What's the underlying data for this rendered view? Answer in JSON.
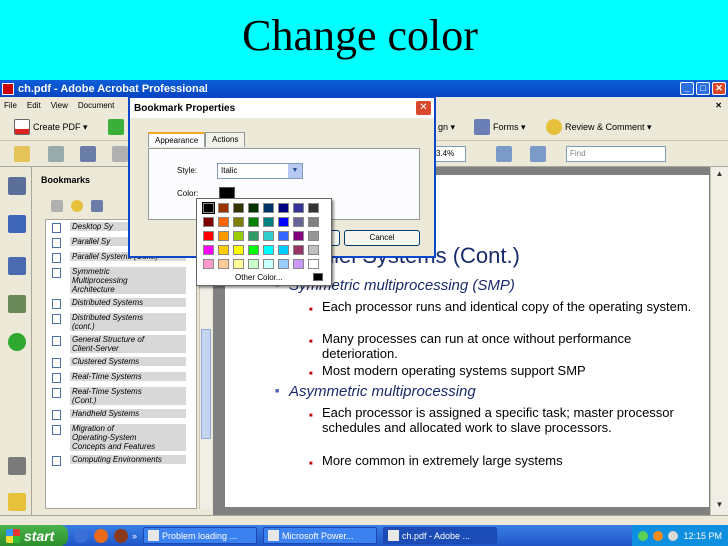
{
  "slide": {
    "title": "Change color"
  },
  "window": {
    "title": "ch.pdf - Adobe Acrobat Professional",
    "minimize": "_",
    "maximize": "□",
    "close": "✕"
  },
  "menu": {
    "items": [
      "File",
      "Edit",
      "View",
      "Document"
    ],
    "close_doc": "✕"
  },
  "toolbar": {
    "create_pdf": "Create PDF ▾",
    "sign": "gn ▾",
    "forms": "Forms ▾",
    "review": "Review & Comment ▾",
    "zoom": "3.4%",
    "find_placeholder": "Find"
  },
  "bookmarks": {
    "header": "Bookmarks",
    "items": [
      "Desktop Sy",
      "Parallel Sy",
      "Parallel Systems (Cont.)",
      "Symmetric\nMultiprocessing\nArchitecture",
      "Distributed Systems",
      "Distributed Systems\n(cont.)",
      "General Structure of\nClient-Server",
      "Clustered Systems",
      "Real-Time Systems",
      "Real-Time Systems\n(Cont.)",
      "Handheld Systems",
      "Migration of\nOperating-System\nConcepts and Features",
      "Computing Environments"
    ]
  },
  "dialog": {
    "title": "Bookmark Properties",
    "close": "✕",
    "tabs": [
      "Appearance",
      "Actions"
    ],
    "style_label": "Style:",
    "style_value": "Italic",
    "color_label": "Color:",
    "ok_label": "",
    "cancel_label": "Cancel"
  },
  "palette": {
    "colors": [
      "#000000",
      "#993300",
      "#333300",
      "#003300",
      "#003366",
      "#000080",
      "#333399",
      "#333333",
      "#800000",
      "#ff6600",
      "#808000",
      "#008000",
      "#008080",
      "#0000ff",
      "#666699",
      "#808080",
      "#ff0000",
      "#ff9900",
      "#99cc00",
      "#339966",
      "#33cccc",
      "#3366ff",
      "#800080",
      "#969696",
      "#ff00ff",
      "#ffcc00",
      "#ffff00",
      "#00ff00",
      "#00ffff",
      "#00ccff",
      "#993366",
      "#c0c0c0",
      "#ff99cc",
      "#ffcc99",
      "#ffff99",
      "#ccffcc",
      "#ccffff",
      "#99ccff",
      "#cc99ff",
      "#ffffff"
    ],
    "other_label": "Other Color..."
  },
  "page": {
    "title": "allel Systems (Cont.)",
    "bullets": [
      {
        "level": 1,
        "text": "Symmetric multiprocessing (SMP)"
      },
      {
        "level": 2,
        "text": "Each processor runs and identical copy of the operating system."
      },
      {
        "level": 2,
        "text": "Many processes can run at once without performance deterioration."
      },
      {
        "level": 2,
        "text": "Most modern operating systems support SMP"
      },
      {
        "level": 1,
        "text": "Asymmetric multiprocessing"
      },
      {
        "level": 2,
        "text": "Each processor is assigned a specific task; master processor schedules and allocated work to slave processors."
      },
      {
        "level": 2,
        "text": "More common in extremely large systems"
      }
    ]
  },
  "taskbar": {
    "start": "start",
    "tasks": [
      "Problem loading ...",
      "Microsoft Power...",
      "ch.pdf - Adobe ..."
    ],
    "clock": "12:15 PM",
    "chevron": "»"
  }
}
